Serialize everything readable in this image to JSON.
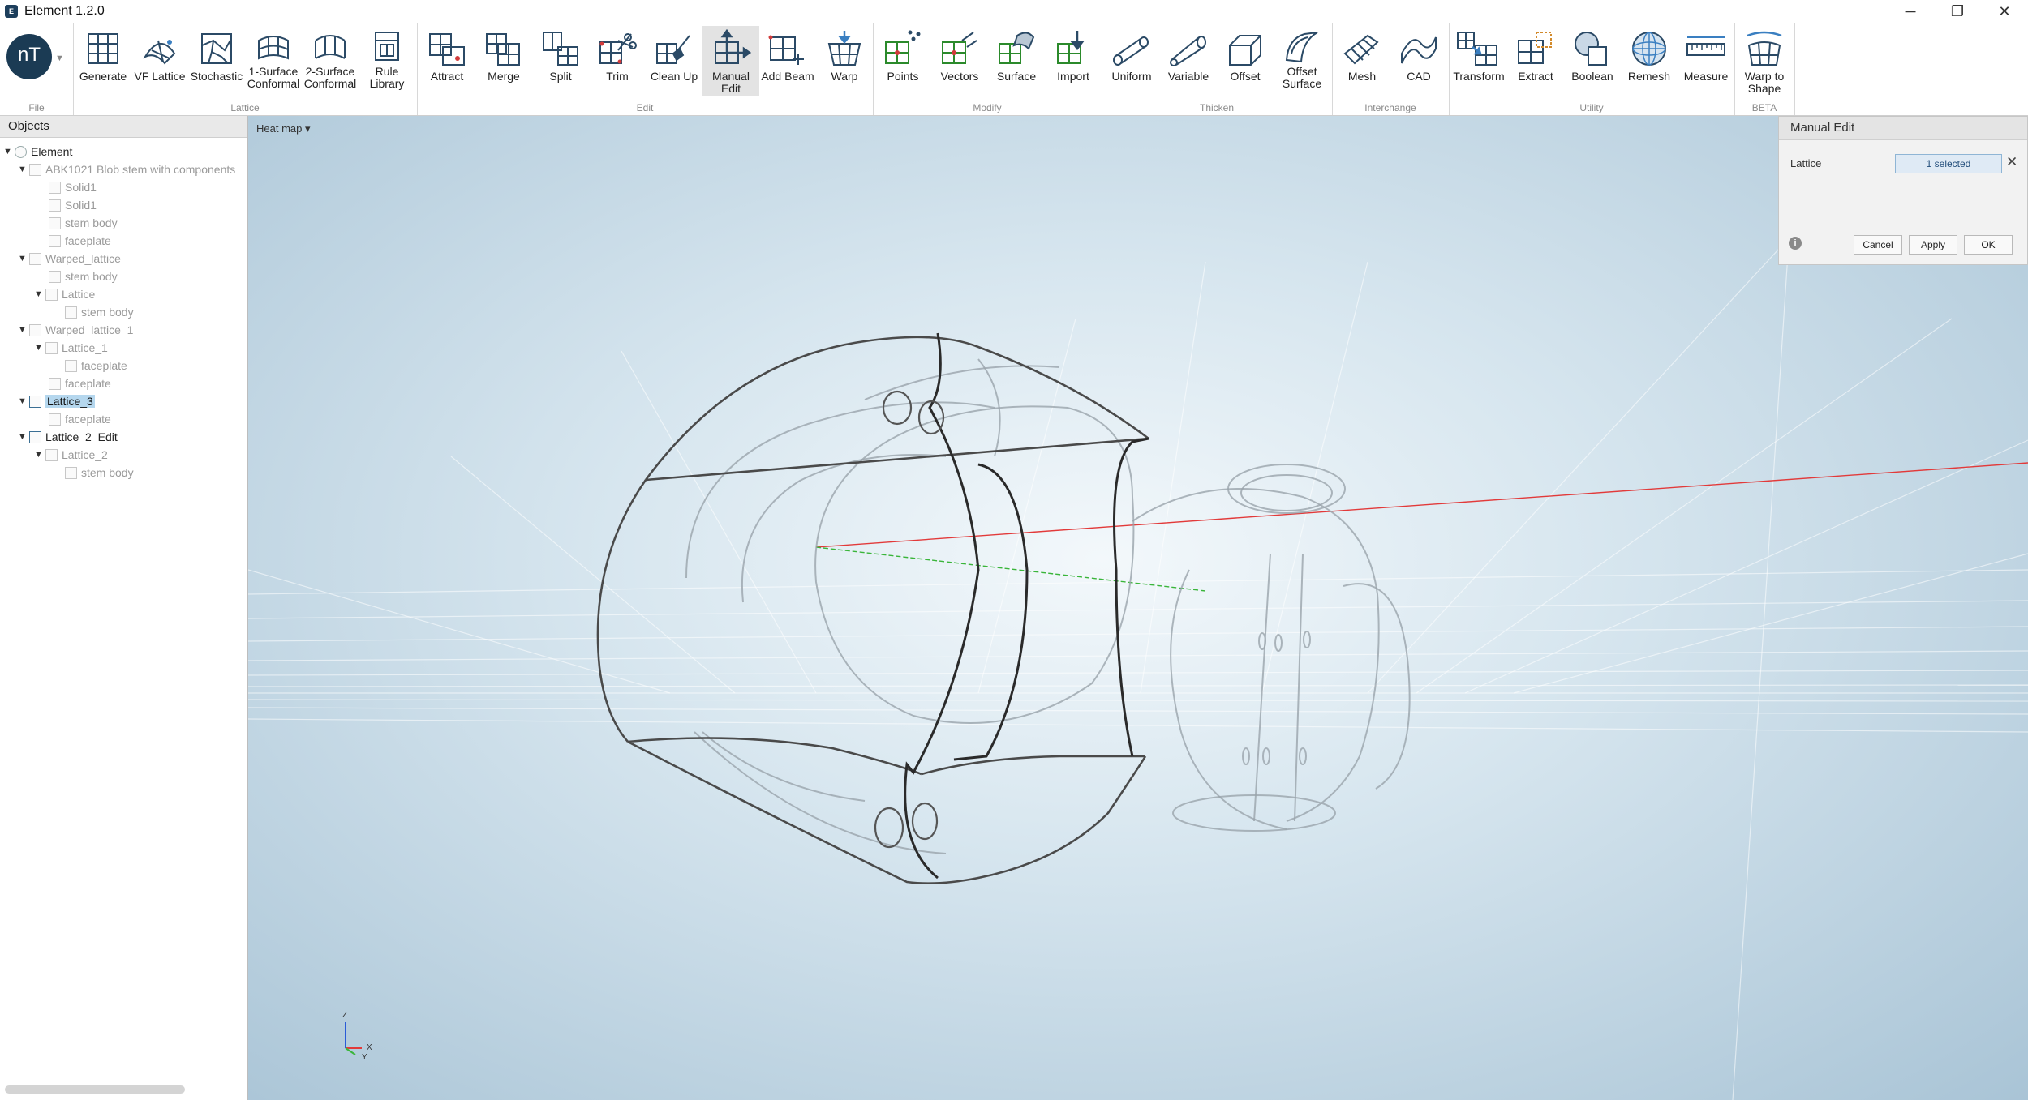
{
  "window": {
    "title": "Element 1.2.0",
    "icon": "element-app-icon",
    "controls": [
      "─",
      "❐",
      "✕"
    ]
  },
  "ribbon": {
    "logo": "nT",
    "groups": [
      {
        "label": "File"
      },
      {
        "label": "Lattice",
        "buttons": [
          "Generate",
          "VF Lattice",
          "Stochastic",
          "1-Surface\nConformal",
          "2-Surface\nConformal",
          "Rule\nLibrary"
        ]
      },
      {
        "label": "Edit",
        "buttons": [
          "Attract",
          "Merge",
          "Split",
          "Trim",
          "Clean Up",
          "Manual\nEdit",
          "Add Beam",
          "Warp"
        ]
      },
      {
        "label": "Modify",
        "buttons": [
          "Points",
          "Vectors",
          "Surface",
          "Import"
        ]
      },
      {
        "label": "Thicken",
        "buttons": [
          "Uniform",
          "Variable",
          "Offset",
          "Offset\nSurface"
        ]
      },
      {
        "label": "Interchange",
        "buttons": [
          "Mesh",
          "CAD"
        ]
      },
      {
        "label": "Utility",
        "buttons": [
          "Transform",
          "Extract",
          "Boolean",
          "Remesh",
          "Measure"
        ]
      },
      {
        "label": "BETA",
        "buttons": [
          "Warp to\nShape"
        ]
      }
    ],
    "active_button": "Manual Edit"
  },
  "objects": {
    "title": "Objects",
    "tree": [
      {
        "label": "Element",
        "state": "normal"
      },
      {
        "label": "ABK1021 Blob stem with components",
        "state": "dim"
      },
      {
        "label": "Solid1",
        "state": "dim"
      },
      {
        "label": "Solid1",
        "state": "dim"
      },
      {
        "label": "stem body",
        "state": "dim"
      },
      {
        "label": "faceplate",
        "state": "dim"
      },
      {
        "label": "Warped_lattice",
        "state": "dim"
      },
      {
        "label": "stem body",
        "state": "dim"
      },
      {
        "label": "Lattice",
        "state": "dim"
      },
      {
        "label": "stem body",
        "state": "dim"
      },
      {
        "label": "Warped_lattice_1",
        "state": "dim"
      },
      {
        "label": "Lattice_1",
        "state": "dim"
      },
      {
        "label": "faceplate",
        "state": "dim"
      },
      {
        "label": "faceplate",
        "state": "dim"
      },
      {
        "label": "Lattice_3",
        "state": "selected"
      },
      {
        "label": "faceplate",
        "state": "dim"
      },
      {
        "label": "Lattice_2_Edit",
        "state": "normal"
      },
      {
        "label": "Lattice_2",
        "state": "dim"
      },
      {
        "label": "stem body",
        "state": "dim"
      }
    ]
  },
  "viewport": {
    "heatmap_label": "Heat map ▾",
    "axis_labels": {
      "z": "Z",
      "x": "X",
      "y": "Y"
    },
    "axis_colors": {
      "x": "#e23a3a",
      "y": "#3ab53a",
      "z": "#2a5bd7"
    }
  },
  "manual_edit": {
    "title": "Manual Edit",
    "field_label": "Lattice",
    "selection_value": "1 selected",
    "cancel_label": "Cancel",
    "apply_label": "Apply",
    "ok_label": "OK"
  }
}
